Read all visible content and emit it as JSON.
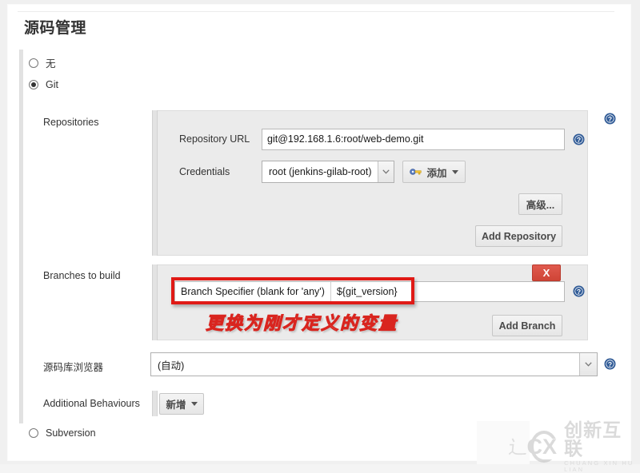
{
  "page": {
    "section_title": "源码管理"
  },
  "scm_options": [
    {
      "label": "无",
      "checked": false,
      "name": "radio-none"
    },
    {
      "label": "Git",
      "checked": true,
      "name": "radio-git"
    },
    {
      "label": "Subversion",
      "checked": false,
      "name": "radio-svn"
    }
  ],
  "repositories": {
    "label": "Repositories",
    "repository_url": {
      "label": "Repository URL",
      "value": "git@192.168.1.6:root/web-demo.git"
    },
    "credentials": {
      "label": "Credentials",
      "selected": "root (jenkins-gilab-root)"
    },
    "add_credentials_button": "添加",
    "advanced_button": "高级...",
    "add_repository_button": "Add Repository"
  },
  "branches": {
    "label": "Branches to build",
    "branch_specifier": {
      "label": "Branch Specifier (blank for 'any')",
      "value": "${git_version}"
    },
    "delete_button": "X",
    "add_branch_button": "Add Branch"
  },
  "repository_browser": {
    "label": "源码库浏览器",
    "selected": "(自动)"
  },
  "additional_behaviours": {
    "label": "Additional Behaviours",
    "add_button": "新增"
  },
  "annotation": {
    "text": "更换为刚才定义的变量",
    "box_color": "#e01a16"
  },
  "watermark": {
    "cn": "创新互联",
    "en": "CHUANG XIN HU LIAN",
    "mark": "CX"
  },
  "icons": {
    "help": "?",
    "key": "key-icon"
  }
}
